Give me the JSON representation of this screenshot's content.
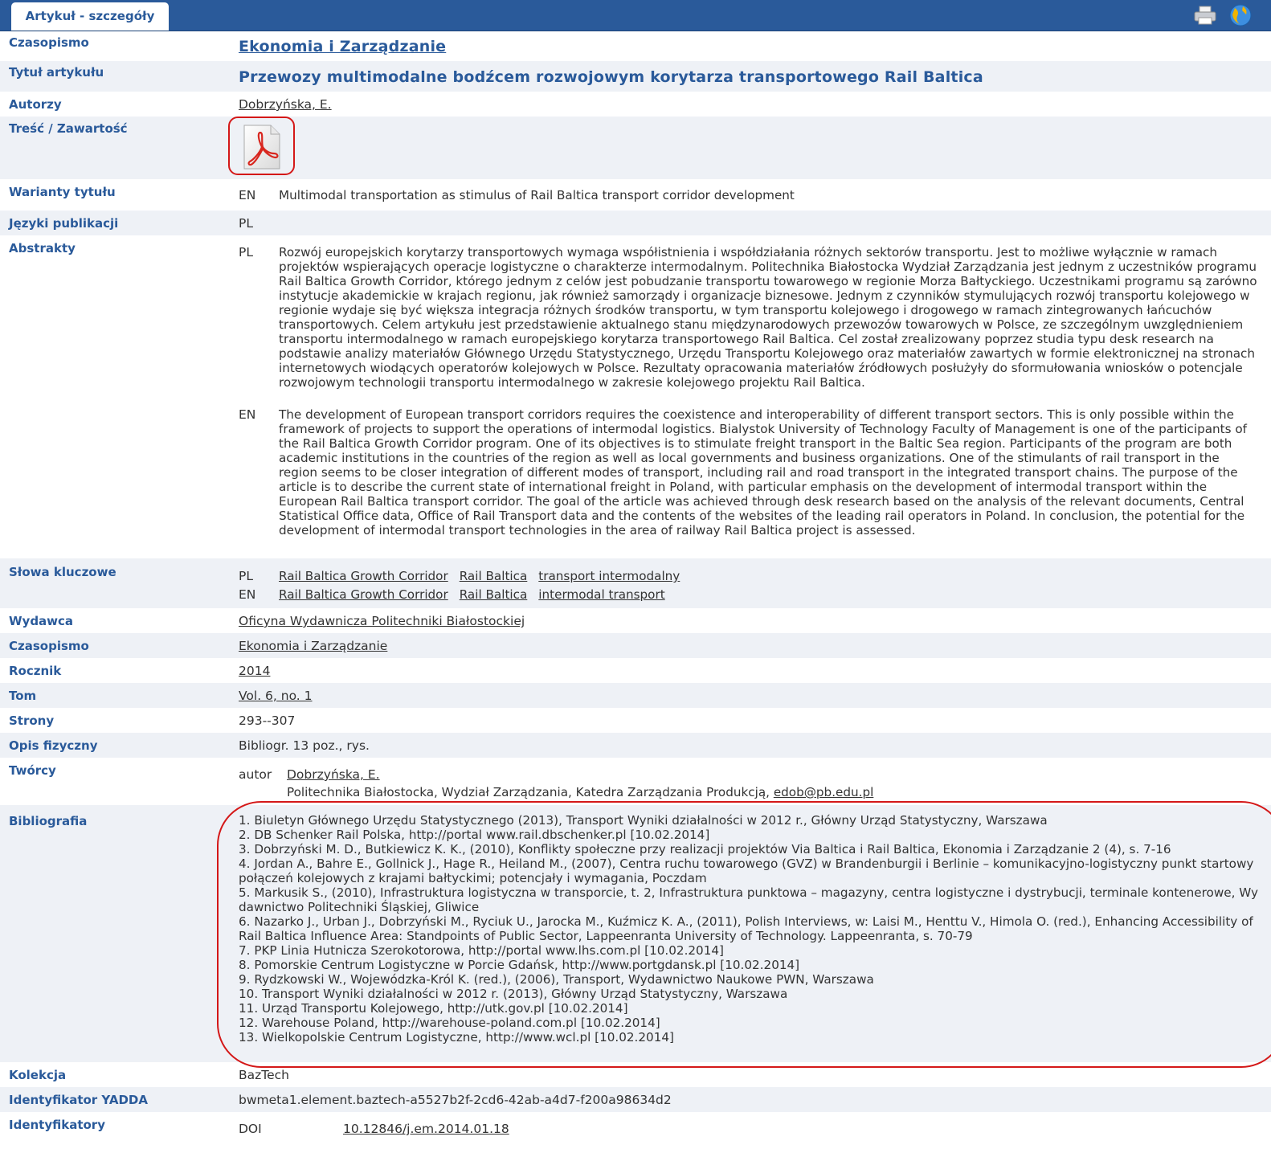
{
  "tab": {
    "label": "Artykuł - szczegóły"
  },
  "icons": {
    "print": "printer-icon",
    "globe": "globe-icon",
    "pdf": "pdf-icon"
  },
  "rows": {
    "czasopismo": {
      "label": "Czasopismo",
      "value": "Ekonomia i Zarządzanie"
    },
    "tytul": {
      "label": "Tytuł artykułu",
      "value": "Przewozy multimodalne bodźcem rozwojowym korytarza transportowego Rail Baltica"
    },
    "autorzy": {
      "label": "Autorzy",
      "value": "Dobrzyńska, E."
    },
    "tresc": {
      "label": "Treść / Zawartość"
    },
    "warianty": {
      "label": "Warianty tytułu",
      "lang": "EN",
      "value": "Multimodal transportation as stimulus of Rail Baltica transport corridor development"
    },
    "jezyki": {
      "label": "Języki publikacji",
      "value": "PL"
    },
    "abstrakty": {
      "label": "Abstrakty",
      "pl_lang": "PL",
      "pl": "Rozwój europejskich korytarzy transportowych wymaga współistnienia i współdziałania różnych sektorów transportu. Jest to możliwe wyłącznie w ramach projektów wspierających operacje logistyczne o charakterze intermodalnym. Politechnika Białostocka Wydział Zarządzania jest jednym z uczestników programu Rail Baltica Growth Corridor, którego jednym z celów jest pobudzanie transportu towarowego w regionie Morza Bałtyckiego. Uczestnikami programu są zarówno instytucje akademickie w krajach regionu, jak również samorządy i organizacje biznesowe. Jednym z czynników stymulujących rozwój transportu kolejowego w regionie wydaje się być większa integracja różnych środków transportu, w tym transportu kolejowego i drogowego w ramach zintegrowanych łańcuchów transportowych. Celem artykułu jest przedstawienie aktualnego stanu międzynarodowych przewozów towarowych w Polsce, ze szczególnym uwzględnieniem transportu intermodalnego w ramach europejskiego korytarza transportowego Rail Baltica. Cel został zrealizowany poprzez studia typu desk research na podstawie analizy materiałów Głównego Urzędu Statystycznego, Urzędu Transportu Kolejowego oraz materiałów zawartych w formie elektronicznej na stronach internetowych wiodących operatorów kolejowych w Polsce. Rezultaty opracowania materiałów źródłowych posłużyły do sformułowania wniosków o potencjale rozwojowym technologii transportu intermodalnego w zakresie kolejowego projektu Rail Baltica.",
      "en_lang": "EN",
      "en": "The development of European transport corridors requires the coexistence and interoperability of different transport sectors. This is only possible within the framework of projects to support the operations of intermodal logistics. Bialystok University of Technology Faculty of Management is one of the participants of the Rail Baltica Growth Corridor program. One of its objectives is to stimulate freight transport in the Baltic Sea region. Participants of the program are both academic institutions in the countries of the region as well as local governments and business organizations. One of the stimulants of rail transport in the region seems to be closer integration of different modes of transport, including rail and road transport in the integrated transport chains. The purpose of the article is to describe the current state of international freight in Poland, with particular emphasis on the development of intermodal transport within the European Rail Baltica transport corridor. The goal of the article was achieved through desk research based on the analysis of the relevant documents, Central Statistical Office data, Office of Rail Transport data and the contents of the websites of the leading rail operators in Poland. In conclusion, the potential for the development of intermodal transport technologies in the area of railway Rail Baltica project is assessed."
    },
    "slowa": {
      "label": "Słowa kluczowe",
      "pl_lang": "PL",
      "pl": [
        "Rail Baltica Growth Corridor",
        "Rail Baltica",
        "transport intermodalny"
      ],
      "en_lang": "EN",
      "en": [
        "Rail Baltica Growth Corridor",
        "Rail Baltica",
        "intermodal transport"
      ]
    },
    "wydawca": {
      "label": "Wydawca",
      "value": "Oficyna Wydawnicza Politechniki Białostockiej"
    },
    "czasopismo2": {
      "label": "Czasopismo",
      "value": "Ekonomia i Zarządzanie"
    },
    "rocznik": {
      "label": "Rocznik",
      "value": "2014"
    },
    "tom": {
      "label": "Tom",
      "value": "Vol. 6, no. 1"
    },
    "strony": {
      "label": "Strony",
      "value": "293--307"
    },
    "opis": {
      "label": "Opis fizyczny",
      "value": "Bibliogr. 13 poz., rys."
    },
    "tworcy": {
      "label": "Twórcy",
      "role": "autor",
      "name": "Dobrzyńska, E.",
      "affiliation": "Politechnika Białostocka, Wydział Zarządzania, Katedra Zarządzania Produkcją,",
      "email": "edob@pb.edu.pl"
    },
    "bibliografia": {
      "label": "Bibliografia",
      "items": [
        "1. Biuletyn Głównego Urzędu Statystycznego (2013), Transport Wyniki działalności w 2012 r., Główny Urząd Statystyczny, Warszawa",
        "2. DB Schenker Rail Polska, http://portal www.rail.dbschenker.pl [10.02.2014]",
        "3. Dobrzyński M. D., Butkiewicz K. K., (2010), Konflikty społeczne przy realizacji projektów Via Baltica i Rail Baltica, Ekonomia i Zarządzanie 2 (4), s. 7-16",
        "4. Jordan A., Bahre E., Gollnick J., Hage R., Heiland M., (2007), Centra ruchu towarowego (GVZ) w Brandenburgii i Berlinie – komunikacyjno-logistyczny punkt startowy połączeń kolejowych z krajami bałtyckimi; potencjały i wymagania, Poczdam",
        "5. Markusik S., (2010), Infrastruktura logistyczna w transporcie, t. 2, Infrastruktura punktowa – magazyny, centra logistyczne i dystrybucji, terminale kontenerowe, Wydawnictwo Politechniki Śląskiej, Gliwice",
        "6. Nazarko J., Urban J., Dobrzyński M., Ryciuk U., Jarocka M., Kuźmicz K. A., (2011), Polish Interviews, w: Laisi M., Henttu V., Himola O. (red.), Enhancing Accessibility of Rail Baltica Influence Area: Standpoints of Public Sector, Lappeenranta University of Technology. Lappeenranta, s. 70-79",
        "7. PKP Linia Hutnicza Szerokotorowa, http://portal www.lhs.com.pl [10.02.2014]",
        "8. Pomorskie Centrum Logistyczne w Porcie Gdańsk, http://www.portgdansk.pl [10.02.2014]",
        "9. Rydzkowski W., Wojewódzka-Król K. (red.), (2006), Transport, Wydawnictwo Naukowe PWN, Warszawa",
        "10. Transport Wyniki działalności w 2012 r. (2013), Główny Urząd Statystyczny, Warszawa",
        "11. Urząd Transportu Kolejowego, http://utk.gov.pl [10.02.2014]",
        "12. Warehouse Poland, http://warehouse-poland.com.pl [10.02.2014]",
        "13. Wielkopolskie Centrum Logistyczne, http://www.wcl.pl [10.02.2014]"
      ]
    },
    "kolekcja": {
      "label": "Kolekcja",
      "value": "BazTech"
    },
    "yadda": {
      "label": "Identyfikator YADDA",
      "value": "bwmeta1.element.baztech-a5527b2f-2cd6-42ab-a4d7-f200a98634d2"
    },
    "identyfikatory": {
      "label": "Identyfikatory",
      "type": "DOI",
      "value": "10.12846/j.em.2014.01.18"
    }
  }
}
